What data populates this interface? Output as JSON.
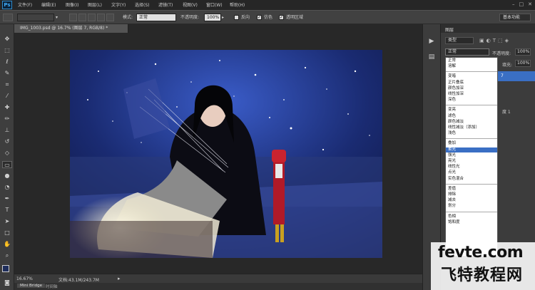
{
  "app": {
    "logo": "Ps"
  },
  "menu": [
    "文件(F)",
    "编辑(E)",
    "图像(I)",
    "图层(L)",
    "文字(Y)",
    "选择(S)",
    "滤镜(T)",
    "视图(V)",
    "窗口(W)",
    "帮助(H)"
  ],
  "window_controls": [
    "–",
    "□",
    "✕"
  ],
  "options": {
    "mode_label": "模式:",
    "mode_value": "正常",
    "opacity_label": "不透明度:",
    "opacity_value": "100%",
    "reverse_label": "反向",
    "dither_label": "仿色",
    "transparency_label": "透明区域",
    "workspace": "基本功能"
  },
  "document": {
    "tab_title": "IMG_1003.psd @ 16.7% (图层 7, RGB/8) *",
    "zoom": "16.67%",
    "doc_info": "文档:43.1M/243.7M"
  },
  "bottom_tabs": [
    "Mini Bridge",
    "时间轴"
  ],
  "layers_panel": {
    "title": "图层",
    "kind_filter": "类型",
    "blend_value": "正常",
    "opacity_label": "不透明度:",
    "opacity_value": "100%",
    "fill_label": "填充:",
    "fill_value": "100%",
    "layer_fragment": "7",
    "layer_fragment2": "度 1"
  },
  "blend_modes": [
    [
      "正常",
      "溶解"
    ],
    [
      "变暗",
      "正片叠底",
      "颜色加深",
      "线性加深",
      "深色"
    ],
    [
      "变亮",
      "滤色",
      "颜色减淡",
      "线性减淡（添加）",
      "浅色"
    ],
    [
      "叠加",
      "柔光",
      "强光",
      "亮光",
      "线性光",
      "点光",
      "实色混合"
    ],
    [
      "差值",
      "排除",
      "减去",
      "划分"
    ],
    [
      "色相",
      "饱和度"
    ]
  ],
  "blend_selected": "柔光",
  "watermark": {
    "line1": "fevte.com",
    "line2": "飞特教程网"
  },
  "colors": {
    "selected_row": "#3a6fc4",
    "ps_blue": "#3fa9f5"
  }
}
